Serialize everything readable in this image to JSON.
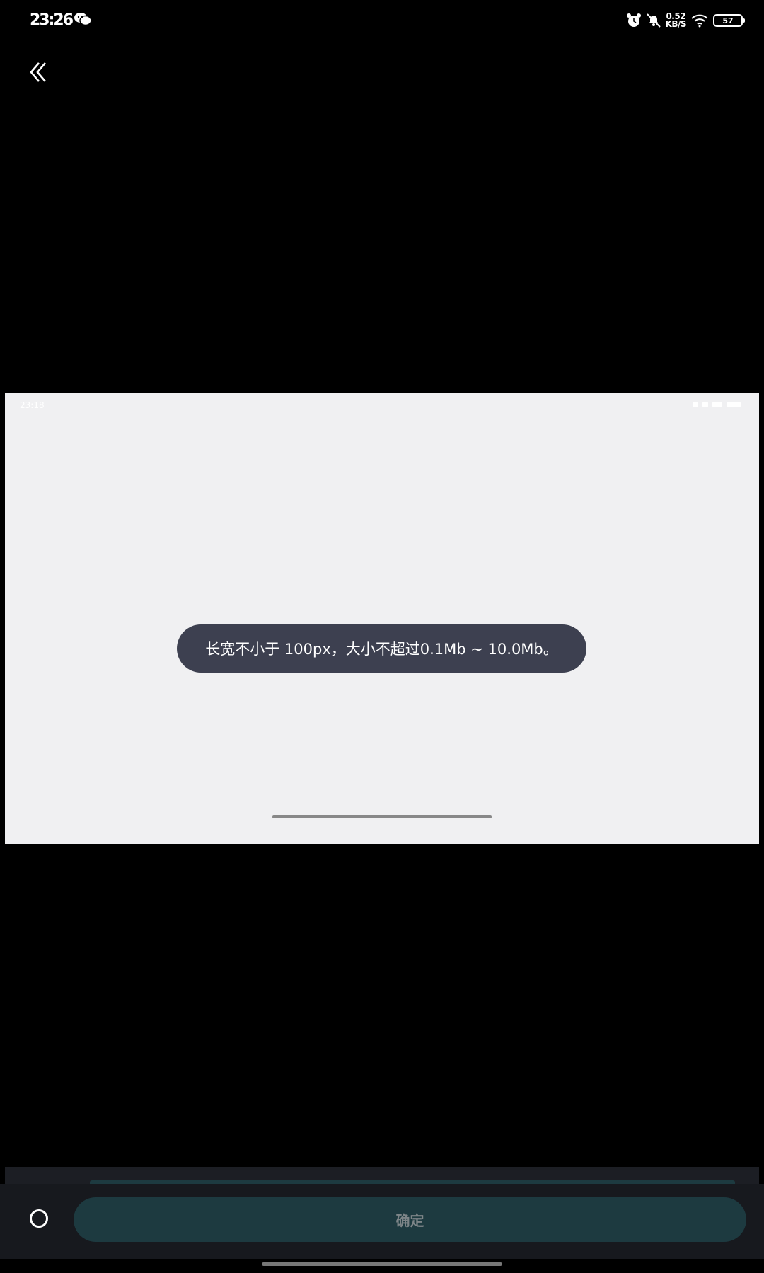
{
  "status_bar": {
    "time": "23:26",
    "net_speed_value": "0.52",
    "net_speed_unit": "KB/S",
    "battery": "57",
    "icons": [
      "wechat-icon",
      "alarm-icon",
      "mute-icon",
      "wifi-icon",
      "battery-icon"
    ]
  },
  "nav": {
    "back_icon": "double-chevron-left-icon"
  },
  "preview": {
    "inner_time": "23:18",
    "toast_text": "长宽不小于 100px，大小不超过0.1Mb ~ 10.0Mb。"
  },
  "bottom_bar": {
    "confirm_label": "确定",
    "radio_checked": false
  },
  "colors": {
    "background": "#000000",
    "preview_background": "#f0f0f2",
    "toast_background": "#3d4050",
    "confirm_button": "#1d3a40",
    "confirm_text": "#7d8588"
  }
}
